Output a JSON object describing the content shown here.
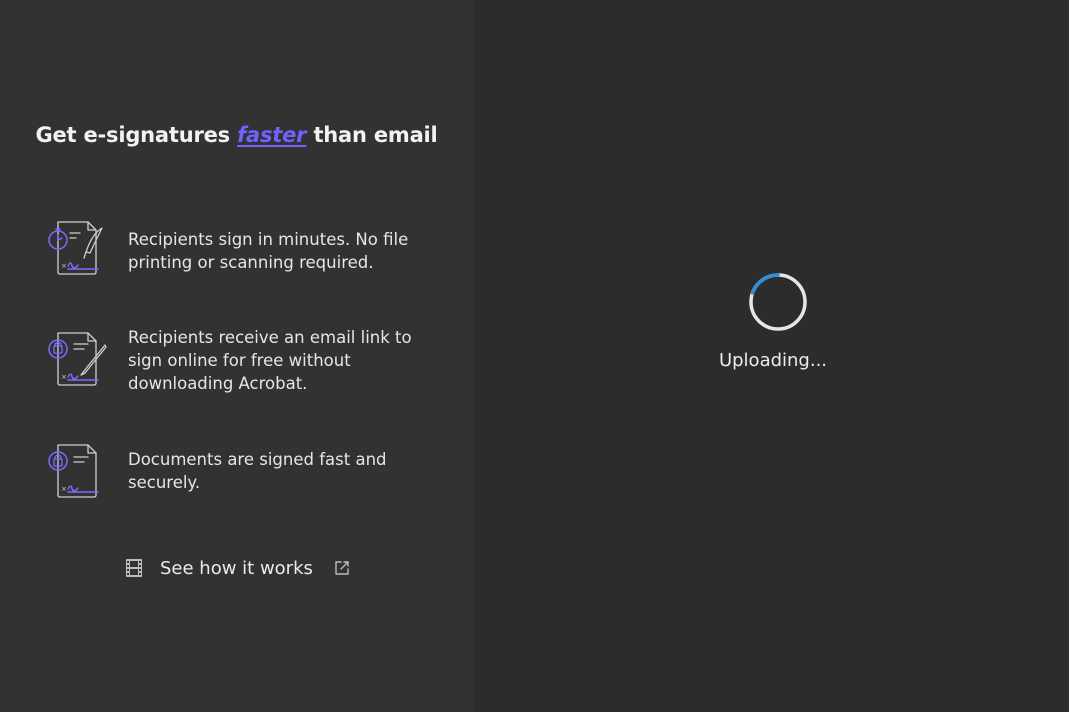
{
  "headline": {
    "before": "Get e-signatures ",
    "accent": "faster",
    "after": " than email"
  },
  "features": [
    {
      "icon": "document-signature-stopwatch-icon",
      "text": "Recipients sign in minutes. No file printing or scanning required."
    },
    {
      "icon": "document-signature-email-link-icon",
      "text": "Recipients receive an email link to sign online for free without downloading Acrobat."
    },
    {
      "icon": "document-signature-lock-icon",
      "text": "Documents are signed fast and securely."
    }
  ],
  "see_how": {
    "label": "See how it works",
    "icon_left": "film-icon",
    "icon_right": "external-link-icon"
  },
  "status": {
    "text": "Uploading..."
  },
  "colors": {
    "left_panel_bg": "#323232",
    "right_panel_bg": "#2c2c2c",
    "accent": "#6f63ff",
    "spinner_blue": "#2f8fd8"
  }
}
